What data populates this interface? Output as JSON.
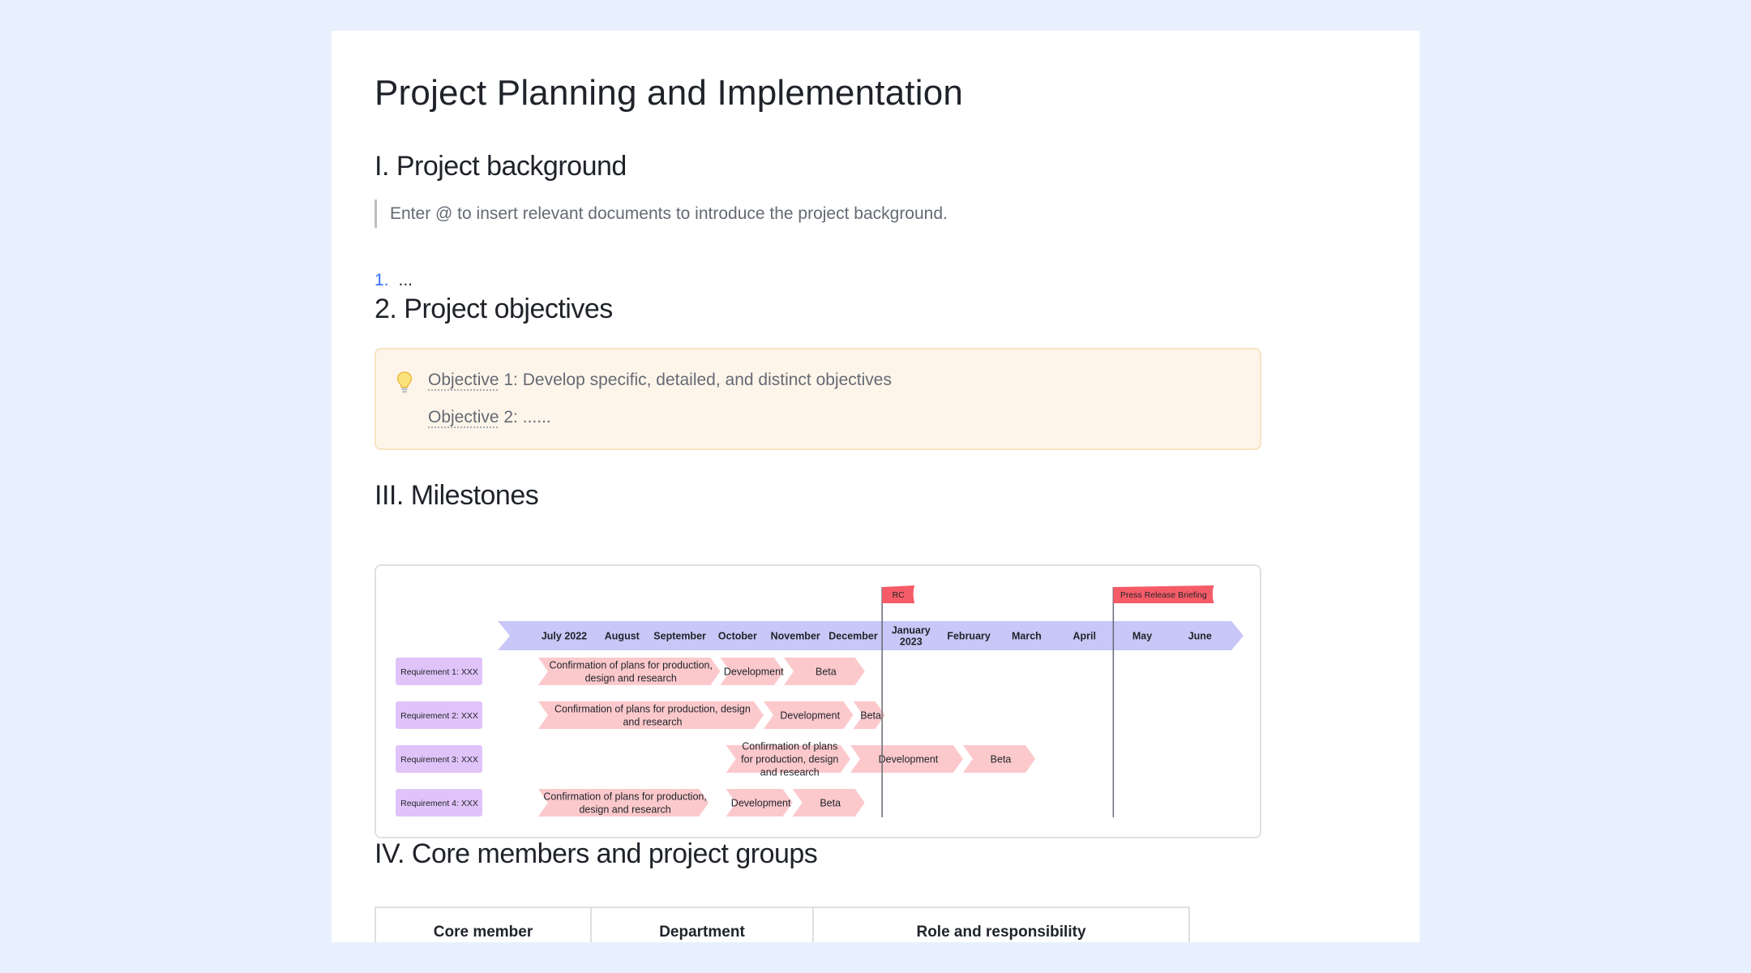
{
  "doc": {
    "title": "Project Planning and Implementation",
    "section1": {
      "heading": "I. Project background",
      "quote": "Enter @ to insert relevant documents to introduce the project background.",
      "list_number": "1.",
      "list_text": "..."
    },
    "section2": {
      "heading": "2. Project objectives",
      "callout_icon": "lightbulb-icon",
      "objective1_word": "Objective",
      "objective1_rest": " 1: Develop specific, detailed, and distinct objectives",
      "objective2_word": "Objective",
      "objective2_rest": " 2: ......"
    },
    "section3": {
      "heading": "III. Milestones"
    },
    "section4": {
      "heading": "IV. Core members and project groups",
      "table_headers": [
        "Core member",
        "Department",
        "Role and responsibility"
      ]
    }
  },
  "milestones": {
    "months": [
      [
        "July 2022"
      ],
      [
        "August"
      ],
      [
        "September"
      ],
      [
        "October"
      ],
      [
        "November"
      ],
      [
        "December"
      ],
      [
        "January",
        "2023"
      ],
      [
        "February"
      ],
      [
        "March"
      ],
      [
        "April"
      ],
      [
        "May"
      ],
      [
        "June"
      ]
    ],
    "flags": [
      {
        "label": "RC",
        "month_index": 5.5
      },
      {
        "label": "Press Release Briefing",
        "month_index": 9.5
      }
    ],
    "requirements": [
      {
        "label": "Requirement 1: XXX",
        "phases": [
          {
            "text": [
              "Confirmation of plans for production,",
              "design and research"
            ],
            "start": -0.45,
            "end": 2.7
          },
          {
            "text": [
              "Development"
            ],
            "start": 2.7,
            "end": 3.8
          },
          {
            "text": [
              "Beta"
            ],
            "start": 3.8,
            "end": 5.2
          }
        ]
      },
      {
        "label": "Requirement 2: XXX",
        "phases": [
          {
            "text": [
              "Confirmation of plans for production, design",
              "and research"
            ],
            "start": -0.45,
            "end": 3.45
          },
          {
            "text": [
              "Development"
            ],
            "start": 3.45,
            "end": 5.0
          },
          {
            "text": [
              "Beta"
            ],
            "start": 5.0,
            "end": 5.55
          }
        ]
      },
      {
        "label": "Requirement 3: XXX",
        "phases": [
          {
            "text": [
              "Confirmation of plans",
              "for production, design",
              "and research"
            ],
            "start": 2.8,
            "end": 4.95
          },
          {
            "text": [
              "Development"
            ],
            "start": 4.95,
            "end": 6.9
          },
          {
            "text": [
              "Beta"
            ],
            "start": 6.9,
            "end": 8.15
          }
        ]
      },
      {
        "label": "Requirement 4: XXX",
        "phases": [
          {
            "text": [
              "Confirmation of plans for production,",
              "design and research"
            ],
            "start": -0.45,
            "end": 2.5
          },
          {
            "text": [
              "Development"
            ],
            "start": 2.8,
            "end": 3.95
          },
          {
            "text": [
              "Beta"
            ],
            "start": 3.95,
            "end": 5.2
          }
        ]
      }
    ],
    "colors": {
      "axis": "#c9c7f7",
      "phase": "#fbc9cc",
      "requirement": "#e0c3f8",
      "flag": "#f55c67",
      "marker": "#646a73"
    }
  }
}
